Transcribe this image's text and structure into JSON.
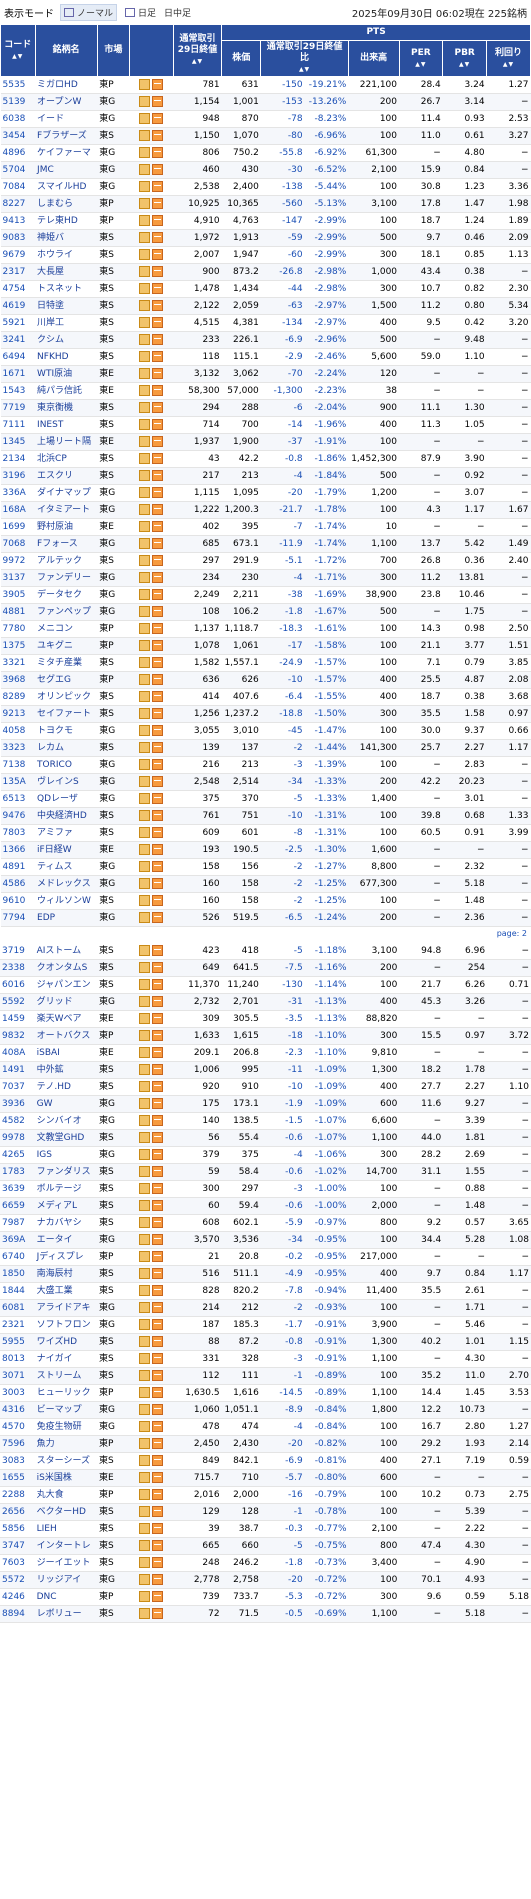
{
  "header": {
    "mode_label": "表示モード",
    "modes": [
      "ノーマル",
      "日足",
      "日中足"
    ],
    "status": "2025年09月30日 06:02現在 225銘柄"
  },
  "columns": {
    "code": "コード",
    "name": "銘柄名",
    "market": "市場",
    "close": "通常取引29日終値",
    "pts": "PTS",
    "price": "株価",
    "change": "通常取引29日終値比",
    "volume": "出来高",
    "per": "PER",
    "pbr": "PBR",
    "yield": "利回り"
  },
  "page_label": "page: 2",
  "rows1": [
    [
      "5535",
      "ミガロHD",
      "東P",
      "781",
      "631",
      "-150",
      "-19.21%",
      "221,100",
      "28.4",
      "3.24",
      "1.27"
    ],
    [
      "5139",
      "オープンW",
      "東G",
      "1,154",
      "1,001",
      "-153",
      "-13.26%",
      "200",
      "26.7",
      "3.14",
      "−"
    ],
    [
      "6038",
      "イード",
      "東G",
      "948",
      "870",
      "-78",
      "-8.23%",
      "100",
      "11.4",
      "0.93",
      "2.53"
    ],
    [
      "3454",
      "Fブラザーズ",
      "東S",
      "1,150",
      "1,070",
      "-80",
      "-6.96%",
      "100",
      "11.0",
      "0.61",
      "3.27"
    ],
    [
      "4896",
      "ケイファーマ",
      "東G",
      "806",
      "750.2",
      "-55.8",
      "-6.92%",
      "61,300",
      "−",
      "4.80",
      "−"
    ],
    [
      "5704",
      "JMC",
      "東G",
      "460",
      "430",
      "-30",
      "-6.52%",
      "2,100",
      "15.9",
      "0.84",
      "−"
    ],
    [
      "7084",
      "スマイルHD",
      "東G",
      "2,538",
      "2,400",
      "-138",
      "-5.44%",
      "100",
      "30.8",
      "1.23",
      "3.36"
    ],
    [
      "8227",
      "しまむら",
      "東P",
      "10,925",
      "10,365",
      "-560",
      "-5.13%",
      "3,100",
      "17.8",
      "1.47",
      "1.98"
    ],
    [
      "9413",
      "テレ東HD",
      "東P",
      "4,910",
      "4,763",
      "-147",
      "-2.99%",
      "100",
      "18.7",
      "1.24",
      "1.89"
    ],
    [
      "9083",
      "神姫バ",
      "東S",
      "1,972",
      "1,913",
      "-59",
      "-2.99%",
      "500",
      "9.7",
      "0.46",
      "2.09"
    ],
    [
      "9679",
      "ホウライ",
      "東S",
      "2,007",
      "1,947",
      "-60",
      "-2.99%",
      "300",
      "18.1",
      "0.85",
      "1.13"
    ],
    [
      "2317",
      "大長屋",
      "東S",
      "900",
      "873.2",
      "-26.8",
      "-2.98%",
      "1,000",
      "43.4",
      "0.38",
      "−"
    ],
    [
      "4754",
      "トスネット",
      "東S",
      "1,478",
      "1,434",
      "-44",
      "-2.98%",
      "300",
      "10.7",
      "0.82",
      "2.30"
    ],
    [
      "4619",
      "日特塗",
      "東S",
      "2,122",
      "2,059",
      "-63",
      "-2.97%",
      "1,500",
      "11.2",
      "0.80",
      "5.34"
    ],
    [
      "5921",
      "川岸工",
      "東S",
      "4,515",
      "4,381",
      "-134",
      "-2.97%",
      "400",
      "9.5",
      "0.42",
      "3.20"
    ],
    [
      "3241",
      "クシム",
      "東S",
      "233",
      "226.1",
      "-6.9",
      "-2.96%",
      "500",
      "−",
      "9.48",
      "−"
    ],
    [
      "6494",
      "NFKHD",
      "東S",
      "118",
      "115.1",
      "-2.9",
      "-2.46%",
      "5,600",
      "59.0",
      "1.10",
      "−"
    ],
    [
      "1671",
      "WTI原油",
      "東E",
      "3,132",
      "3,062",
      "-70",
      "-2.24%",
      "120",
      "−",
      "−",
      "−"
    ],
    [
      "1543",
      "純パラ信託",
      "東E",
      "58,300",
      "57,000",
      "-1,300",
      "-2.23%",
      "38",
      "−",
      "−",
      "−"
    ],
    [
      "7719",
      "東京衡機",
      "東S",
      "294",
      "288",
      "-6",
      "-2.04%",
      "900",
      "11.1",
      "1.30",
      "−"
    ],
    [
      "7111",
      "INEST",
      "東S",
      "714",
      "700",
      "-14",
      "-1.96%",
      "400",
      "11.3",
      "1.05",
      "−"
    ],
    [
      "1345",
      "上場リート隔",
      "東E",
      "1,937",
      "1,900",
      "-37",
      "-1.91%",
      "100",
      "−",
      "−",
      "−"
    ],
    [
      "2134",
      "北浜CP",
      "東S",
      "43",
      "42.2",
      "-0.8",
      "-1.86%",
      "1,452,300",
      "87.9",
      "3.90",
      "−"
    ],
    [
      "3196",
      "エスクリ",
      "東S",
      "217",
      "213",
      "-4",
      "-1.84%",
      "500",
      "−",
      "0.92",
      "−"
    ],
    [
      "336A",
      "ダイナマップ",
      "東G",
      "1,115",
      "1,095",
      "-20",
      "-1.79%",
      "1,200",
      "−",
      "3.07",
      "−"
    ],
    [
      "168A",
      "イタミアート",
      "東G",
      "1,222",
      "1,200.3",
      "-21.7",
      "-1.78%",
      "100",
      "4.3",
      "1.17",
      "1.67"
    ],
    [
      "1699",
      "野村原油",
      "東E",
      "402",
      "395",
      "-7",
      "-1.74%",
      "10",
      "−",
      "−",
      "−"
    ],
    [
      "7068",
      "Fフォース",
      "東G",
      "685",
      "673.1",
      "-11.9",
      "-1.74%",
      "1,100",
      "13.7",
      "5.42",
      "1.49"
    ],
    [
      "9972",
      "アルテック",
      "東S",
      "297",
      "291.9",
      "-5.1",
      "-1.72%",
      "700",
      "26.8",
      "0.36",
      "2.40"
    ],
    [
      "3137",
      "ファンデリー",
      "東G",
      "234",
      "230",
      "-4",
      "-1.71%",
      "300",
      "11.2",
      "13.81",
      "−"
    ],
    [
      "3905",
      "データセク",
      "東G",
      "2,249",
      "2,211",
      "-38",
      "-1.69%",
      "38,900",
      "23.8",
      "10.46",
      "−"
    ],
    [
      "4881",
      "ファンペップ",
      "東G",
      "108",
      "106.2",
      "-1.8",
      "-1.67%",
      "500",
      "−",
      "1.75",
      "−"
    ],
    [
      "7780",
      "メニコン",
      "東P",
      "1,137",
      "1,118.7",
      "-18.3",
      "-1.61%",
      "100",
      "14.3",
      "0.98",
      "2.50"
    ],
    [
      "1375",
      "ユキグニ",
      "東P",
      "1,078",
      "1,061",
      "-17",
      "-1.58%",
      "100",
      "21.1",
      "3.77",
      "1.51"
    ],
    [
      "3321",
      "ミタチ産業",
      "東S",
      "1,582",
      "1,557.1",
      "-24.9",
      "-1.57%",
      "100",
      "7.1",
      "0.79",
      "3.85"
    ],
    [
      "3968",
      "セグエG",
      "東P",
      "636",
      "626",
      "-10",
      "-1.57%",
      "400",
      "25.5",
      "4.87",
      "2.08"
    ],
    [
      "8289",
      "オリンピック",
      "東S",
      "414",
      "407.6",
      "-6.4",
      "-1.55%",
      "400",
      "18.7",
      "0.38",
      "3.68"
    ],
    [
      "9213",
      "セイファート",
      "東S",
      "1,256",
      "1,237.2",
      "-18.8",
      "-1.50%",
      "300",
      "35.5",
      "1.58",
      "0.97"
    ],
    [
      "4058",
      "トヨクモ",
      "東G",
      "3,055",
      "3,010",
      "-45",
      "-1.47%",
      "100",
      "30.0",
      "9.37",
      "0.66"
    ],
    [
      "3323",
      "レカム",
      "東S",
      "139",
      "137",
      "-2",
      "-1.44%",
      "141,300",
      "25.7",
      "2.27",
      "1.17"
    ],
    [
      "7138",
      "TORICO",
      "東G",
      "216",
      "213",
      "-3",
      "-1.39%",
      "100",
      "−",
      "2.83",
      "−"
    ],
    [
      "135A",
      "ヴレインS",
      "東G",
      "2,548",
      "2,514",
      "-34",
      "-1.33%",
      "200",
      "42.2",
      "20.23",
      "−"
    ],
    [
      "6513",
      "QDレーザ",
      "東G",
      "375",
      "370",
      "-5",
      "-1.33%",
      "1,400",
      "−",
      "3.01",
      "−"
    ],
    [
      "9476",
      "中央経済HD",
      "東S",
      "761",
      "751",
      "-10",
      "-1.31%",
      "100",
      "39.8",
      "0.68",
      "1.33"
    ],
    [
      "7803",
      "アミファ",
      "東S",
      "609",
      "601",
      "-8",
      "-1.31%",
      "100",
      "60.5",
      "0.91",
      "3.99"
    ],
    [
      "1366",
      "iF日経W",
      "東E",
      "193",
      "190.5",
      "-2.5",
      "-1.30%",
      "1,600",
      "−",
      "−",
      "−"
    ],
    [
      "4891",
      "ティムス",
      "東G",
      "158",
      "156",
      "-2",
      "-1.27%",
      "8,800",
      "−",
      "2.32",
      "−"
    ],
    [
      "4586",
      "メドレックス",
      "東G",
      "160",
      "158",
      "-2",
      "-1.25%",
      "677,300",
      "−",
      "5.18",
      "−"
    ],
    [
      "9610",
      "ウィルソンW",
      "東S",
      "160",
      "158",
      "-2",
      "-1.25%",
      "100",
      "−",
      "1.48",
      "−"
    ],
    [
      "7794",
      "EDP",
      "東G",
      "526",
      "519.5",
      "-6.5",
      "-1.24%",
      "200",
      "−",
      "2.36",
      "−"
    ]
  ],
  "rows2": [
    [
      "3719",
      "AIストーム",
      "東S",
      "423",
      "418",
      "-5",
      "-1.18%",
      "3,100",
      "94.8",
      "6.96",
      "−"
    ],
    [
      "2338",
      "クオンタムS",
      "東S",
      "649",
      "641.5",
      "-7.5",
      "-1.16%",
      "200",
      "−",
      "254",
      "−"
    ],
    [
      "6016",
      "ジャパンエン",
      "東S",
      "11,370",
      "11,240",
      "-130",
      "-1.14%",
      "100",
      "21.7",
      "6.26",
      "0.71"
    ],
    [
      "5592",
      "グリッド",
      "東G",
      "2,732",
      "2,701",
      "-31",
      "-1.13%",
      "400",
      "45.3",
      "3.26",
      "−"
    ],
    [
      "1459",
      "楽天Wベア",
      "東E",
      "309",
      "305.5",
      "-3.5",
      "-1.13%",
      "88,820",
      "−",
      "−",
      "−"
    ],
    [
      "9832",
      "オートバクス",
      "東P",
      "1,633",
      "1,615",
      "-18",
      "-1.10%",
      "300",
      "15.5",
      "0.97",
      "3.72"
    ],
    [
      "408A",
      "iSBAI",
      "東E",
      "209.1",
      "206.8",
      "-2.3",
      "-1.10%",
      "9,810",
      "−",
      "−",
      "−"
    ],
    [
      "1491",
      "中外鉱",
      "東S",
      "1,006",
      "995",
      "-11",
      "-1.09%",
      "1,300",
      "18.2",
      "1.78",
      "−"
    ],
    [
      "7037",
      "テノ.HD",
      "東S",
      "920",
      "910",
      "-10",
      "-1.09%",
      "400",
      "27.7",
      "2.27",
      "1.10"
    ],
    [
      "3936",
      "GW",
      "東G",
      "175",
      "173.1",
      "-1.9",
      "-1.09%",
      "600",
      "11.6",
      "9.27",
      "−"
    ],
    [
      "4582",
      "シンバイオ",
      "東G",
      "140",
      "138.5",
      "-1.5",
      "-1.07%",
      "6,600",
      "−",
      "3.39",
      "−"
    ],
    [
      "9978",
      "文教堂GHD",
      "東S",
      "56",
      "55.4",
      "-0.6",
      "-1.07%",
      "1,100",
      "44.0",
      "1.81",
      "−"
    ],
    [
      "4265",
      "IGS",
      "東G",
      "379",
      "375",
      "-4",
      "-1.06%",
      "300",
      "28.2",
      "2.69",
      "−"
    ],
    [
      "1783",
      "ファンダリス",
      "東S",
      "59",
      "58.4",
      "-0.6",
      "-1.02%",
      "14,700",
      "31.1",
      "1.55",
      "−"
    ],
    [
      "3639",
      "ボルテージ",
      "東S",
      "300",
      "297",
      "-3",
      "-1.00%",
      "100",
      "−",
      "0.88",
      "−"
    ],
    [
      "6659",
      "メディアL",
      "東S",
      "60",
      "59.4",
      "-0.6",
      "-1.00%",
      "2,000",
      "−",
      "1.48",
      "−"
    ],
    [
      "7987",
      "ナカバヤシ",
      "東S",
      "608",
      "602.1",
      "-5.9",
      "-0.97%",
      "800",
      "9.2",
      "0.57",
      "3.65"
    ],
    [
      "369A",
      "エータイ",
      "東G",
      "3,570",
      "3,536",
      "-34",
      "-0.95%",
      "100",
      "34.4",
      "5.28",
      "1.08"
    ],
    [
      "6740",
      "Jディスプレ",
      "東P",
      "21",
      "20.8",
      "-0.2",
      "-0.95%",
      "217,000",
      "−",
      "−",
      "−"
    ],
    [
      "1850",
      "南海辰村",
      "東S",
      "516",
      "511.1",
      "-4.9",
      "-0.95%",
      "400",
      "9.7",
      "0.84",
      "1.17"
    ],
    [
      "1844",
      "大盛工業",
      "東S",
      "828",
      "820.2",
      "-7.8",
      "-0.94%",
      "11,400",
      "35.5",
      "2.61",
      "−"
    ],
    [
      "6081",
      "アライドアキ",
      "東G",
      "214",
      "212",
      "-2",
      "-0.93%",
      "100",
      "−",
      "1.71",
      "−"
    ],
    [
      "2321",
      "ソフトフロン",
      "東G",
      "187",
      "185.3",
      "-1.7",
      "-0.91%",
      "3,900",
      "−",
      "5.46",
      "−"
    ],
    [
      "5955",
      "ワイズHD",
      "東S",
      "88",
      "87.2",
      "-0.8",
      "-0.91%",
      "1,300",
      "40.2",
      "1.01",
      "1.15"
    ],
    [
      "8013",
      "ナイガイ",
      "東S",
      "331",
      "328",
      "-3",
      "-0.91%",
      "1,100",
      "−",
      "4.30",
      "−"
    ],
    [
      "3071",
      "ストリーム",
      "東S",
      "112",
      "111",
      "-1",
      "-0.89%",
      "100",
      "35.2",
      "11.0",
      "2.70"
    ],
    [
      "3003",
      "ヒューリック",
      "東P",
      "1,630.5",
      "1,616",
      "-14.5",
      "-0.89%",
      "1,100",
      "14.4",
      "1.45",
      "3.53"
    ],
    [
      "4316",
      "ビーマップ",
      "東G",
      "1,060",
      "1,051.1",
      "-8.9",
      "-0.84%",
      "1,800",
      "12.2",
      "10.73",
      "−"
    ],
    [
      "4570",
      "免疫生物研",
      "東G",
      "478",
      "474",
      "-4",
      "-0.84%",
      "100",
      "16.7",
      "2.80",
      "1.27"
    ],
    [
      "7596",
      "魚力",
      "東P",
      "2,450",
      "2,430",
      "-20",
      "-0.82%",
      "100",
      "29.2",
      "1.93",
      "2.14"
    ],
    [
      "3083",
      "スターシーズ",
      "東S",
      "849",
      "842.1",
      "-6.9",
      "-0.81%",
      "400",
      "27.1",
      "7.19",
      "0.59"
    ],
    [
      "1655",
      "iS米国株",
      "東E",
      "715.7",
      "710",
      "-5.7",
      "-0.80%",
      "600",
      "−",
      "−",
      "−"
    ],
    [
      "2288",
      "丸大食",
      "東P",
      "2,016",
      "2,000",
      "-16",
      "-0.79%",
      "100",
      "10.2",
      "0.73",
      "2.75"
    ],
    [
      "2656",
      "ベクターHD",
      "東S",
      "129",
      "128",
      "-1",
      "-0.78%",
      "100",
      "−",
      "5.39",
      "−"
    ],
    [
      "5856",
      "LIEH",
      "東S",
      "39",
      "38.7",
      "-0.3",
      "-0.77%",
      "2,100",
      "−",
      "2.22",
      "−"
    ],
    [
      "3747",
      "インタートレ",
      "東S",
      "665",
      "660",
      "-5",
      "-0.75%",
      "800",
      "47.4",
      "4.30",
      "−"
    ],
    [
      "7603",
      "ジーイエット",
      "東S",
      "248",
      "246.2",
      "-1.8",
      "-0.73%",
      "3,400",
      "−",
      "4.90",
      "−"
    ],
    [
      "5572",
      "リッジアイ",
      "東G",
      "2,778",
      "2,758",
      "-20",
      "-0.72%",
      "100",
      "70.1",
      "4.93",
      "−"
    ],
    [
      "4246",
      "DNC",
      "東P",
      "739",
      "733.7",
      "-5.3",
      "-0.72%",
      "300",
      "9.6",
      "0.59",
      "5.18"
    ],
    [
      "8894",
      "レボリュー",
      "東S",
      "72",
      "71.5",
      "-0.5",
      "-0.69%",
      "1,100",
      "−",
      "5.18",
      "−"
    ]
  ]
}
